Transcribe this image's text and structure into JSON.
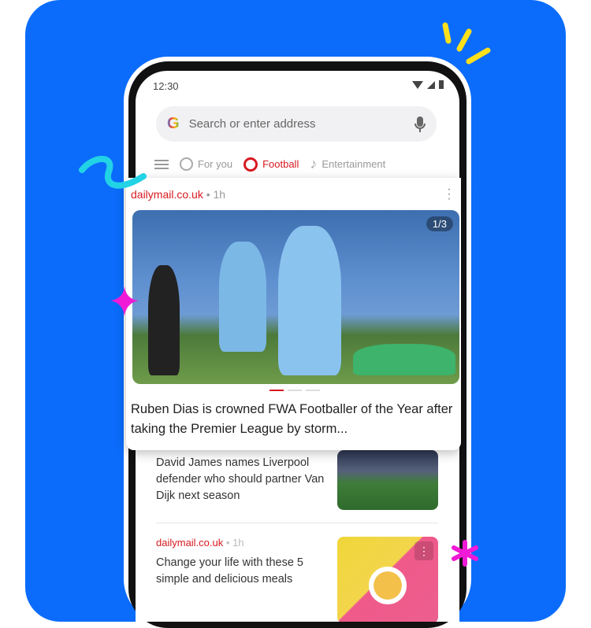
{
  "status_bar": {
    "time": "12:30"
  },
  "search": {
    "placeholder": "Search or enter address",
    "logo": "G"
  },
  "tabs": [
    {
      "label": "For you",
      "icon": "globe-icon"
    },
    {
      "label": "Football",
      "icon": "football-icon",
      "active": true
    },
    {
      "label": "Entertainment",
      "icon": "music-note-icon"
    }
  ],
  "featured": {
    "source": "dailymail.co.uk",
    "time": "1h",
    "counter": "1/3",
    "headline": "Ruben Dias is crowned FWA Footballer of the Year after taking the Premier League by storm...",
    "slide": 1,
    "slides": 3
  },
  "list": [
    {
      "headline": "David James names Liverpool defender who should partner Van Dijk next season"
    },
    {
      "source": "dailymail.co.uk",
      "time": "1h",
      "headline": "Change your life with these 5 simple and delicious meals"
    }
  ],
  "colors": {
    "background": "#0b6cfb",
    "accent": "#d71920"
  }
}
